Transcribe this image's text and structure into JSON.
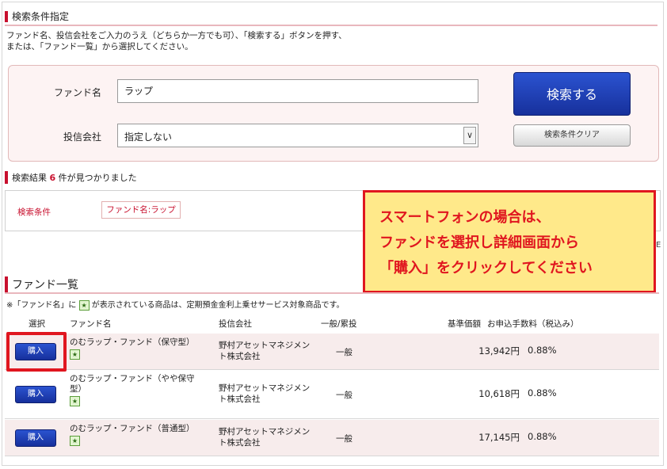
{
  "search": {
    "heading": "検索条件指定",
    "instruction_line1": "ファンド名、投信会社をご入力のうえ（どちらか一方でも可）、「検索する」ボタンを押す、",
    "instruction_line2": "または、「ファンド一覧」から選択してください。",
    "fund_label": "ファンド名",
    "fund_value": "ラップ",
    "company_label": "投信会社",
    "company_value": "指定しない",
    "search_button": "検索する",
    "clear_button": "検索条件クリア"
  },
  "results": {
    "prefix": "検索結果",
    "count": "6",
    "suffix": "件が見つかりました",
    "condition_label": "検索条件",
    "condition_value": "ファンド名:ラップ"
  },
  "callout": {
    "line1": "スマートフォンの場合は、",
    "line2": "ファンドを選択し詳細画面から",
    "line3": "「購入」をクリックしてください",
    "side_mark": "E"
  },
  "fund_list": {
    "title": "ファンド一覧",
    "note_before": "※「ファンド名」に",
    "note_after": "が表示されている商品は、定期預金金利上乗せサービス対象商品です。",
    "star_glyph": "★",
    "columns": [
      "選択",
      "ファンド名",
      "投信会社",
      "一般/累投",
      "基準価額",
      "お申込手数料（税込み）"
    ],
    "rows": [
      {
        "button": "購入",
        "name": "のむラップ・ファンド（保守型）",
        "company": "野村アセットマネジメント株式会社",
        "type": "一般",
        "price": "13,942円",
        "fee": "0.88%"
      },
      {
        "button": "購入",
        "name": "のむラップ・ファンド（やや保守型）",
        "company": "野村アセットマネジメント株式会社",
        "type": "一般",
        "price": "10,618円",
        "fee": "0.88%"
      },
      {
        "button": "購入",
        "name": "のむラップ・ファンド（普通型）",
        "company": "野村アセットマネジメント株式会社",
        "type": "一般",
        "price": "17,145円",
        "fee": "0.88%"
      }
    ]
  },
  "colors": {
    "accent": "#c8102e",
    "button_blue": "#1f3fb8",
    "callout_bg": "#ffe98a",
    "callout_border": "#e0161f"
  }
}
